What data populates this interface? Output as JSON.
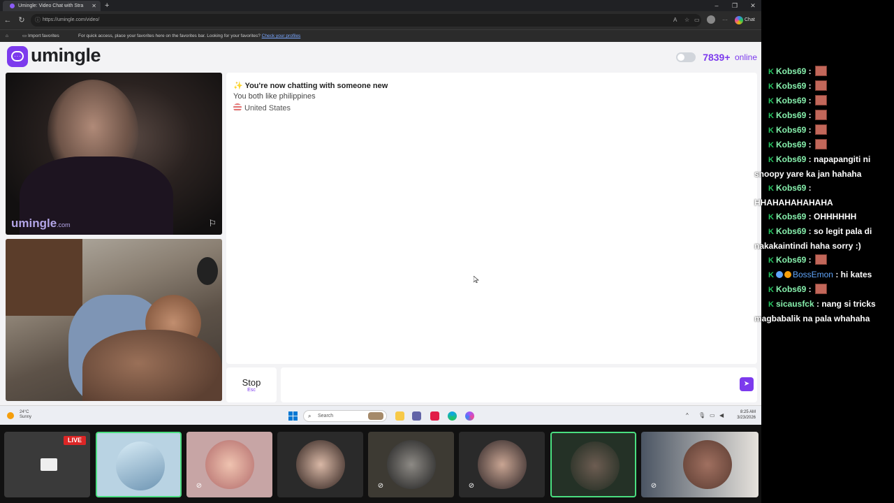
{
  "browser": {
    "tab_title": "Umingle: Video Chat with Stra",
    "url": "https://umingle.com/video/",
    "chat_button": "Chat",
    "favorites_bar": {
      "import_label": "Import favorites",
      "hint_text": "For quick access, place your favorites here on the favorites bar. Looking for your favorites?",
      "link_text": "Check your profiles"
    }
  },
  "site": {
    "logo_text": "umingle",
    "online_count": "7839+",
    "online_label": "online",
    "watermark": "umingle",
    "watermark_suffix": ".com",
    "chat": {
      "line1": "You're now chatting with someone new",
      "line2": "You both like philippines",
      "country": "United States"
    },
    "stop_label": "Stop",
    "stop_hint": "Esc"
  },
  "taskbar": {
    "weather_temp": "24°C",
    "weather_desc": "Sunny",
    "search_placeholder": "Search",
    "time": "8:25 AM",
    "date": "3/23/2026"
  },
  "stream": {
    "live_label": "LIVE",
    "chat_messages": [
      {
        "user": "Kobs69",
        "text": "",
        "emote": true
      },
      {
        "user": "Kobs69",
        "text": "",
        "emote": true
      },
      {
        "user": "Kobs69",
        "text": "",
        "emote": true
      },
      {
        "user": "Kobs69",
        "text": "",
        "emote": true
      },
      {
        "user": "Kobs69",
        "text": "",
        "emote": true
      },
      {
        "user": "Kobs69",
        "text": "",
        "emote": true
      },
      {
        "user": "Kobs69",
        "text": "napapangiti ni",
        "cont": "snoopy yare ka jan hahaha"
      },
      {
        "user": "Kobs69",
        "text": "",
        "cont": "HHAHAHAHAHAHA"
      },
      {
        "user": "Kobs69",
        "text": "OHHHHHH"
      },
      {
        "user": "Kobs69",
        "text": "so legit pala di",
        "cont": "nakakaintindi haha sorry :)"
      },
      {
        "user": "Kobs69",
        "text": "",
        "emote": true
      },
      {
        "user": "BossEmon",
        "text": "hi kates"
      },
      {
        "user": "Kobs69",
        "text": "",
        "emote": true
      },
      {
        "user": "sicausfck",
        "text": "nang si tricks",
        "cont": "magbabalik na pala whahaha"
      }
    ]
  }
}
